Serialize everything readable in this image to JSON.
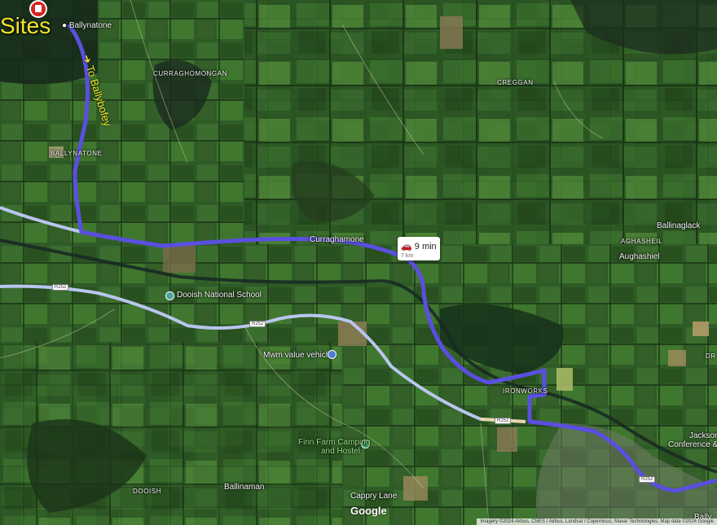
{
  "title": "Sites",
  "direction_label": "To Ballybofey",
  "travel": {
    "icon": "car-icon",
    "time": "9 min",
    "distance": "7 km"
  },
  "places": {
    "ballynatone_top": "Ballynatone",
    "curraghomongan": "CURRAGHOMONGAN",
    "creggan": "CREGGAN",
    "ballynatone": "BALLYNATONE",
    "curraghamone": "Curraghamone",
    "ballinaglack": "Ballinaglack",
    "aghasheil_caps": "AGHASHEIL",
    "aughashiel": "Aughashiel",
    "dooish_school": "Dooish National School",
    "mwm": "Mwm value vehicles",
    "ironworks": "IRONWORKS",
    "finn_farm_1": "Finn Farm Camping",
    "finn_farm_2": "and Hostel",
    "dooish": "DOOISH",
    "ballinamon": "Ballinaman",
    "cappry_lane": "Cappry Lane",
    "jackson_1": "Jackson's",
    "jackson_2": "Conference & Le",
    "ballyb": "Bally",
    "dr": "DR"
  },
  "road_shields": [
    "R252",
    "R252",
    "R252",
    "R252"
  ],
  "brand": "Google",
  "attribution": "Imagery ©2024 Airbus, CNES / Airbus, Landsat / Copernicus, Maxar Technologies, Map data ©2024 Google",
  "colors": {
    "route": "#5a4fe0",
    "alt_route": "#b9c6ee",
    "label_yellow": "#f5e628",
    "marker_red": "#d82222"
  }
}
